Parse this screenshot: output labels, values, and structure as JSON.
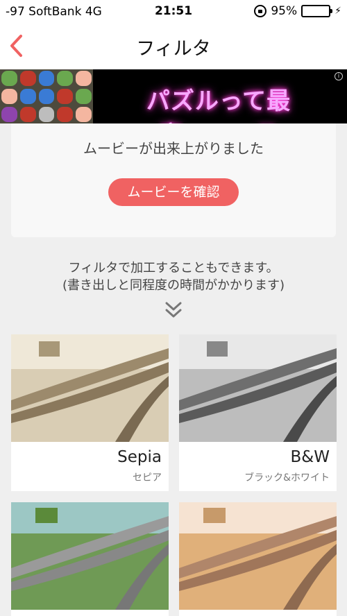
{
  "status_bar": {
    "carrier": "-97 SoftBank   4G",
    "time": "21:51",
    "battery": "95%"
  },
  "nav": {
    "title": "フィルタ"
  },
  "ad": {
    "text": "パズルって最高・・・♥",
    "info": "i"
  },
  "movie_card": {
    "message": "ムービーが出来上がりました",
    "button_label": "ムービーを確認"
  },
  "filter_info": {
    "line1": "フィルタで加工することもできます。",
    "line2": "(書き出しと同程度の時間がかかります)"
  },
  "filters": [
    {
      "name": "Sepia",
      "subtitle": "セピア",
      "tint": "#c8b79a"
    },
    {
      "name": "B&W",
      "subtitle": "ブラック&ホワイト",
      "tint": "#9a9a9a"
    },
    {
      "name": "",
      "subtitle": "",
      "tint": "#7fb07a"
    },
    {
      "name": "",
      "subtitle": "",
      "tint": "#d9a56f"
    }
  ],
  "colors": {
    "accent": "#f06262",
    "battery_fill": "#4cd964",
    "background": "#efefef"
  }
}
